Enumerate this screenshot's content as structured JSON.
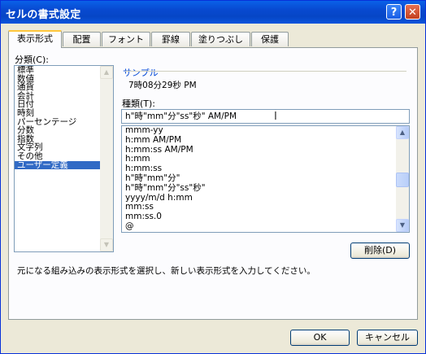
{
  "window": {
    "title": "セルの書式設定",
    "help_glyph": "?",
    "close_glyph": "✕"
  },
  "tabs": [
    "表示形式",
    "配置",
    "フォント",
    "罫線",
    "塗りつぶし",
    "保護"
  ],
  "category": {
    "label": "分類(C):",
    "items": [
      "標準",
      "数値",
      "通貨",
      "会計",
      "日付",
      "時刻",
      "パーセンテージ",
      "分数",
      "指数",
      "文字列",
      "その他",
      "ユーザー定義"
    ],
    "selected": "ユーザー定義"
  },
  "sample": {
    "label": "サンプル",
    "value": "7時08分29秒 PM"
  },
  "type": {
    "label": "種類(T):",
    "value": "h\"時\"mm\"分\"ss\"秒\" AM/PM",
    "list": [
      "mmm-yy",
      "h:mm AM/PM",
      "h:mm:ss AM/PM",
      "h:mm",
      "h:mm:ss",
      "h\"時\"mm\"分\"",
      "h\"時\"mm\"分\"ss\"秒\"",
      "yyyy/m/d h:mm",
      "mm:ss",
      "mm:ss.0",
      "@"
    ]
  },
  "delete_button": "削除(D)",
  "description": "元になる組み込みの表示形式を選択し、新しい表示形式を入力してください。",
  "ok_button": "OK",
  "cancel_button": "キャンセル",
  "colors": {
    "titlebar": "#0846d4",
    "selection": "#316ac5",
    "active_tab_accent": "#ffc73c",
    "group_label": "#0046d5"
  }
}
